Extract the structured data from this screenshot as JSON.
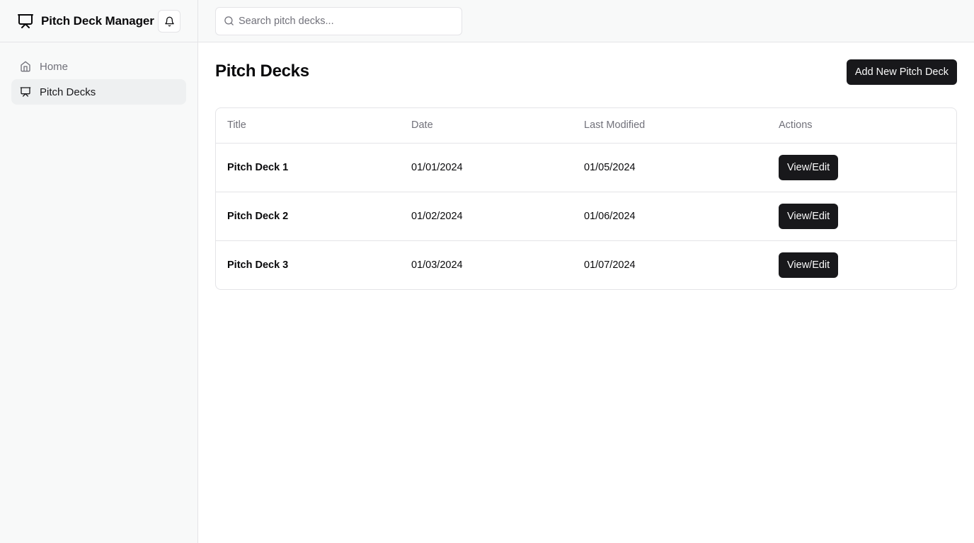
{
  "app": {
    "title": "Pitch Deck Manager",
    "brand_icon": "presentation-icon",
    "notification_icon": "bell-icon"
  },
  "sidebar": {
    "items": [
      {
        "label": "Home",
        "icon": "home-icon",
        "active": false
      },
      {
        "label": "Pitch Decks",
        "icon": "presentation-icon",
        "active": true
      }
    ]
  },
  "search": {
    "placeholder": "Search pitch decks...",
    "value": ""
  },
  "main": {
    "title": "Pitch Decks",
    "add_button_label": "Add New Pitch Deck",
    "table": {
      "columns": [
        "Title",
        "Date",
        "Last Modified",
        "Actions"
      ],
      "rows": [
        {
          "title": "Pitch Deck 1",
          "date": "01/01/2024",
          "last_modified": "01/05/2024",
          "action_label": "View/Edit"
        },
        {
          "title": "Pitch Deck 2",
          "date": "01/02/2024",
          "last_modified": "01/06/2024",
          "action_label": "View/Edit"
        },
        {
          "title": "Pitch Deck 3",
          "date": "01/03/2024",
          "last_modified": "01/07/2024",
          "action_label": "View/Edit"
        }
      ]
    }
  },
  "colors": {
    "primary": "#18181b",
    "muted_text": "#71717a",
    "border": "#e4e4e7",
    "sidebar_bg": "#f8f9f9",
    "active_item_bg": "#eef0f1"
  }
}
